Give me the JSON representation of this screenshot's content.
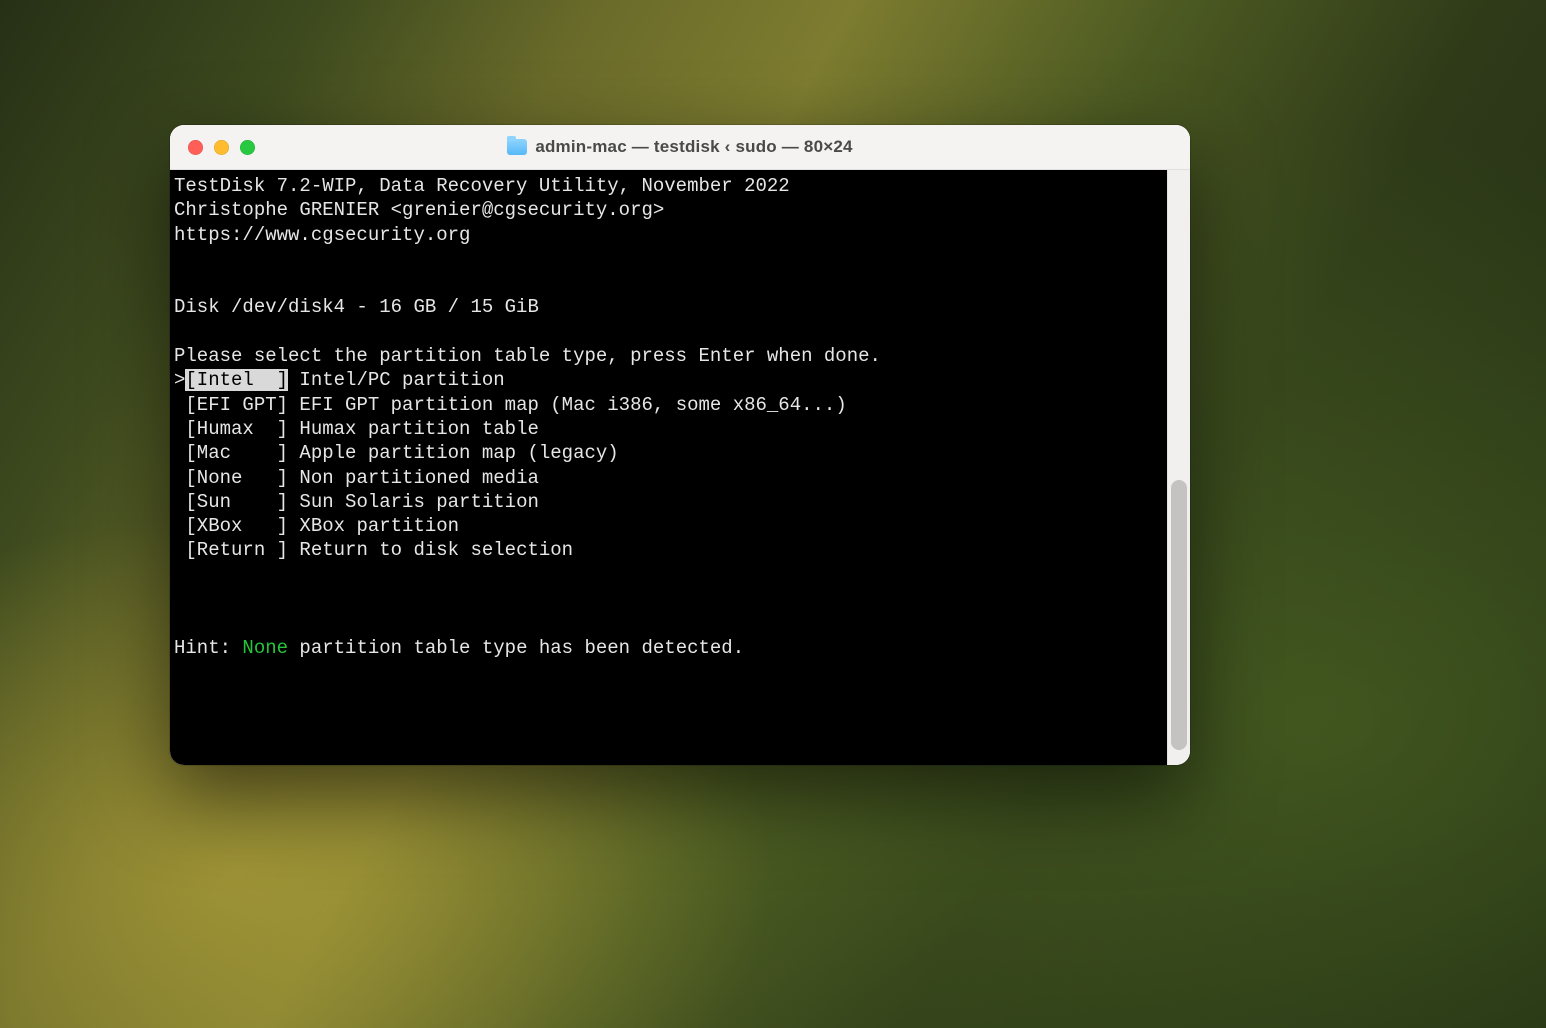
{
  "window": {
    "title": "admin-mac — testdisk ‹ sudo — 80×24"
  },
  "header": {
    "line1": "TestDisk 7.2-WIP, Data Recovery Utility, November 2022",
    "line2": "Christophe GRENIER <grenier@cgsecurity.org>",
    "line3": "https://www.cgsecurity.org"
  },
  "disk_line": "Disk /dev/disk4 - 16 GB / 15 GiB",
  "prompt": "Please select the partition table type, press Enter when done.",
  "options": [
    {
      "tag": "[Intel  ]",
      "desc": " Intel/PC partition",
      "selected": true
    },
    {
      "tag": "[EFI GPT]",
      "desc": " EFI GPT partition map (Mac i386, some x86_64...)",
      "selected": false
    },
    {
      "tag": "[Humax  ]",
      "desc": " Humax partition table",
      "selected": false
    },
    {
      "tag": "[Mac    ]",
      "desc": " Apple partition map (legacy)",
      "selected": false
    },
    {
      "tag": "[None   ]",
      "desc": " Non partitioned media",
      "selected": false
    },
    {
      "tag": "[Sun    ]",
      "desc": " Sun Solaris partition",
      "selected": false
    },
    {
      "tag": "[XBox   ]",
      "desc": " XBox partition",
      "selected": false
    },
    {
      "tag": "[Return ]",
      "desc": " Return to disk selection",
      "selected": false
    }
  ],
  "hint": {
    "prefix": "Hint: ",
    "highlight": "None",
    "suffix": " partition table type has been detected."
  }
}
